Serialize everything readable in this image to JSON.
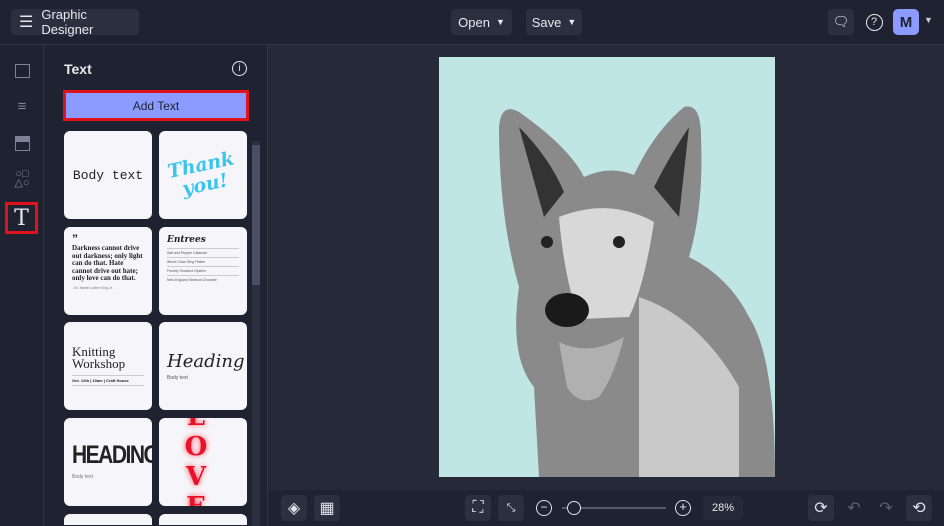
{
  "header": {
    "title": "Graphic Designer",
    "open_label": "Open",
    "save_label": "Save",
    "avatar_initial": "M"
  },
  "panel": {
    "title": "Text",
    "add_text_label": "Add Text",
    "cards": {
      "body_text": "Body text",
      "thank_you": "Thank you!",
      "quote": "Darkness cannot drive out darkness; only light can do that. Hate cannot drive out hate; only love can do that.",
      "quote_author": "- Dr. Martin Luther King Jr.",
      "menu_title": "Entrees",
      "menu_items": [
        "Salt and Pepper Calamari",
        "Whole Clam Ring Platter",
        "Freshly Shucked Oysters",
        "New England Seafood Chowder"
      ],
      "knitting_title": "Knitting Workshop",
      "knitting_sub": "Oct. 12th | 10am | Craft House",
      "script_heading": "Heading",
      "script_body": "Body text",
      "bold_heading": "HEADING",
      "bold_body": "Body text",
      "love": "LOVE"
    }
  },
  "toolbar": {
    "zoom_value": "28%",
    "zoom_fraction": 0.05
  },
  "colors": {
    "accent": "#8c9bff",
    "highlight": "#e0121b"
  }
}
